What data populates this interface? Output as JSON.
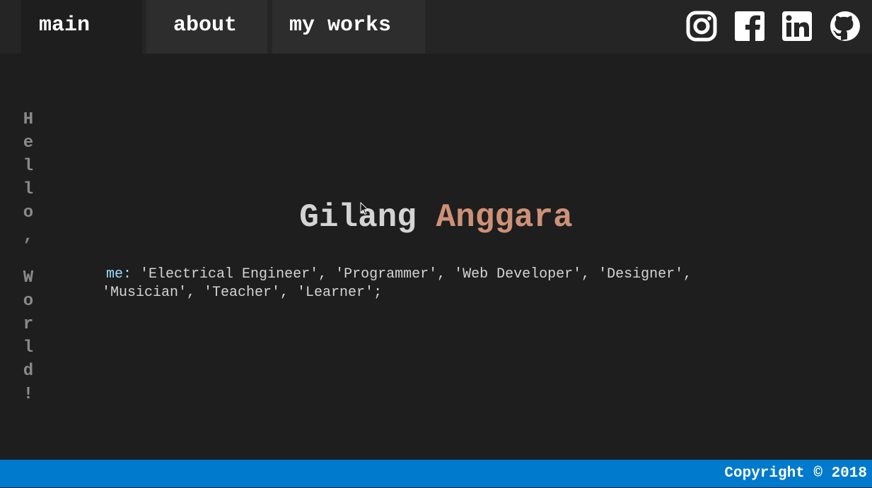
{
  "nav": {
    "tabs": [
      {
        "label": "main"
      },
      {
        "label": "about"
      },
      {
        "label": "my works"
      }
    ],
    "social": [
      "instagram-icon",
      "facebook-icon",
      "linkedin-icon",
      "github-icon"
    ]
  },
  "sidebar": {
    "greeting": "Hello, World!"
  },
  "hero": {
    "first_name": "Gilang",
    "last_name": "Anggara"
  },
  "roles": {
    "key": "me:",
    "line1": "'Electrical Engineer', 'Programmer', 'Web Developer', 'Designer',",
    "line2": "'Musician', 'Teacher', 'Learner';"
  },
  "footer": {
    "copyright": "Copyright © 2018"
  },
  "colors": {
    "background": "#1e1e1e",
    "topbar": "#252526",
    "accent_name": "#ce9178",
    "key": "#9cdcfe",
    "footer": "#007acc"
  }
}
